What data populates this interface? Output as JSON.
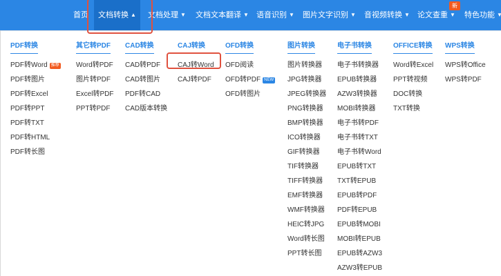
{
  "nav": {
    "items": [
      {
        "label": "首页",
        "caret": false
      },
      {
        "label": "文档转换",
        "caret": true
      },
      {
        "label": "文档处理",
        "caret": true
      },
      {
        "label": "文档文本翻译",
        "caret": true
      },
      {
        "label": "语音识别",
        "caret": true
      },
      {
        "label": "图片文字识别",
        "caret": true
      },
      {
        "label": "音视频转换",
        "caret": true
      },
      {
        "label": "论文查重",
        "caret": true
      },
      {
        "label": "特色功能",
        "caret": true
      }
    ],
    "caret_symbol": "▼",
    "active_caret_symbol": "▲",
    "new_badge": "新"
  },
  "menu": {
    "columns": [
      {
        "title": "PDF转换",
        "items": [
          {
            "label": "PDF转Word",
            "tag": "推荐"
          },
          {
            "label": "PDF转图片"
          },
          {
            "label": "PDF转Excel"
          },
          {
            "label": "PDF转PPT"
          },
          {
            "label": "PDF转TXT"
          },
          {
            "label": "PDF转HTML"
          },
          {
            "label": "PDF转长图"
          }
        ]
      },
      {
        "title": "其它转PDF",
        "items": [
          {
            "label": "Word转PDF"
          },
          {
            "label": "图片转PDF"
          },
          {
            "label": "Excel转PDF"
          },
          {
            "label": "PPT转PDF"
          }
        ]
      },
      {
        "title": "CAD转换",
        "items": [
          {
            "label": "CAD转PDF"
          },
          {
            "label": "CAD转图片"
          },
          {
            "label": "PDF转CAD"
          },
          {
            "label": "CAD版本转换"
          }
        ]
      },
      {
        "title": "CAJ转换",
        "items": [
          {
            "label": "CAJ转Word"
          },
          {
            "label": "CAJ转PDF"
          }
        ]
      },
      {
        "title": "OFD转换",
        "items": [
          {
            "label": "OFD阅读"
          },
          {
            "label": "OFD转PDF",
            "tag": "NEW"
          },
          {
            "label": "OFD转图片"
          }
        ]
      },
      {
        "title": "图片转换",
        "items": [
          {
            "label": "图片转换器"
          },
          {
            "label": "JPG转换器"
          },
          {
            "label": "JPEG转换器"
          },
          {
            "label": "PNG转换器"
          },
          {
            "label": "BMP转换器"
          },
          {
            "label": "ICO转换器"
          },
          {
            "label": "GIF转换器"
          },
          {
            "label": "TIF转换器"
          },
          {
            "label": "TIFF转换器"
          },
          {
            "label": "EMF转换器"
          },
          {
            "label": "WMF转换器"
          },
          {
            "label": "HEIC转JPG"
          },
          {
            "label": "Word转长图"
          },
          {
            "label": "PPT转长图"
          }
        ]
      },
      {
        "title": "电子书转换",
        "items": [
          {
            "label": "电子书转换器"
          },
          {
            "label": "EPUB转换器"
          },
          {
            "label": "AZW3转换器"
          },
          {
            "label": "MOBI转换器"
          },
          {
            "label": "电子书转PDF"
          },
          {
            "label": "电子书转TXT"
          },
          {
            "label": "电子书转Word"
          },
          {
            "label": "EPUB转TXT"
          },
          {
            "label": "TXT转EPUB"
          },
          {
            "label": "EPUB转PDF"
          },
          {
            "label": "PDF转EPUB"
          },
          {
            "label": "EPUB转MOBI"
          },
          {
            "label": "MOBI转EPUB"
          },
          {
            "label": "EPUB转AZW3"
          },
          {
            "label": "AZW3转EPUB"
          }
        ]
      },
      {
        "title": "OFFICE转换",
        "items": [
          {
            "label": "Word转Excel"
          },
          {
            "label": "PPT转视频"
          },
          {
            "label": "DOC转换"
          },
          {
            "label": "TXT转换"
          }
        ]
      },
      {
        "title": "WPS转换",
        "items": [
          {
            "label": "WPS转Office"
          },
          {
            "label": "WPS转PDF"
          }
        ]
      }
    ]
  },
  "colors": {
    "accent": "#2b86e4",
    "highlight": "#e0513e",
    "hot_tag": "#f25a1f"
  }
}
